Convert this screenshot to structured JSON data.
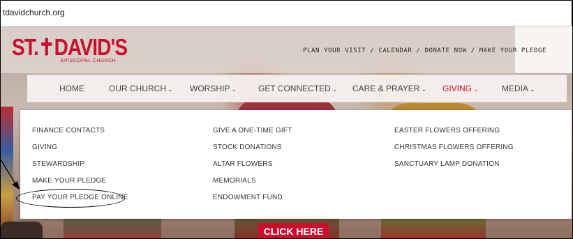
{
  "browser": {
    "url": "tdavidchurch.org"
  },
  "logo": {
    "name": "ST.✝DAVID'S",
    "subtitle": "EPISCOPAL CHURCH"
  },
  "top_links": [
    "PLAN YOUR VISIT",
    "CALENDAR",
    "DONATE NOW",
    "MAKE YOUR PLEDGE"
  ],
  "top_links_separator": "/",
  "nav": {
    "chevron": "⌄",
    "items": [
      {
        "label": "HOME",
        "has_menu": false
      },
      {
        "label": "OUR CHURCH",
        "has_menu": true
      },
      {
        "label": "WORSHIP",
        "has_menu": true
      },
      {
        "label": "GET CONNECTED",
        "has_menu": true
      },
      {
        "label": "CARE & PRAYER",
        "has_menu": true
      },
      {
        "label": "GIVING",
        "has_menu": true,
        "active": true
      },
      {
        "label": "MEDIA",
        "has_menu": true
      }
    ]
  },
  "dropdown": {
    "columns": [
      [
        "FINANCE CONTACTS",
        "GIVING",
        "STEWARDSHIP",
        "MAKE YOUR PLEDGE",
        "PAY YOUR PLEDGE ONLINE"
      ],
      [
        "GIVE A ONE-TIME GIFT",
        "STOCK DONATIONS",
        "ALTAR FLOWERS",
        "MEMORIALS",
        "ENDOWMENT FUND"
      ],
      [
        "EASTER FLOWERS OFFERING",
        "CHRISTMAS FLOWERS OFFERING",
        "SANCTUARY LAMP DONATION"
      ]
    ]
  },
  "cta": {
    "label": "CLICK HERE"
  },
  "colors": {
    "accent": "#c8102e",
    "nav_text": "#444444"
  }
}
